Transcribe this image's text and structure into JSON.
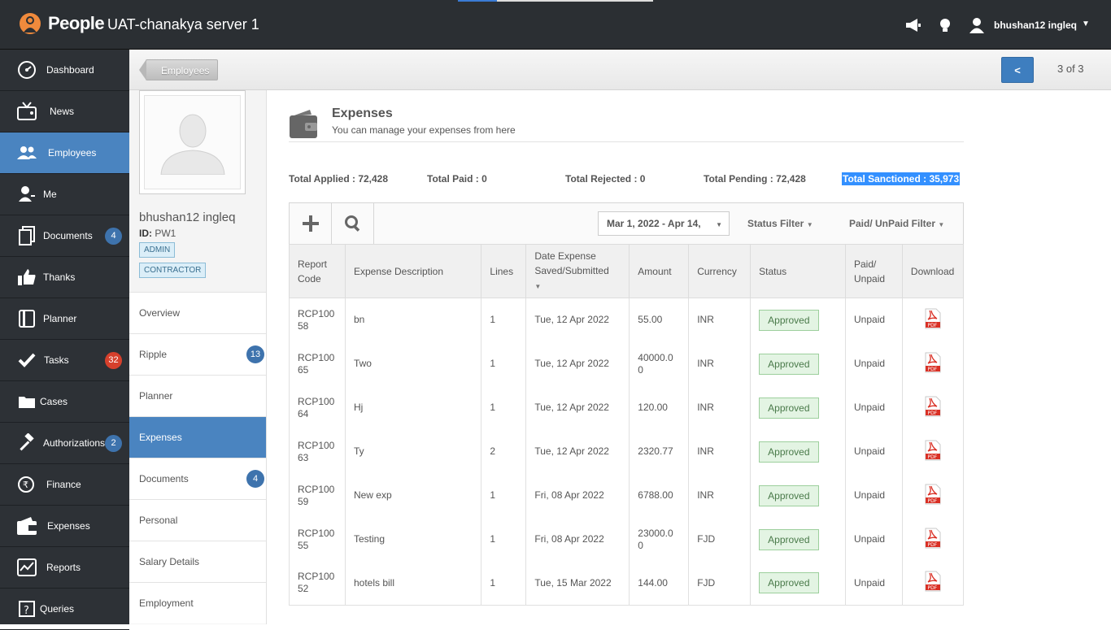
{
  "header": {
    "brand": "People",
    "server": "UAT-chanakya server 1",
    "user_name": "bhushan12 ingleq",
    "progress_fraction": 0.2
  },
  "sidebar": {
    "items": [
      {
        "label": "Dashboard",
        "icon": "dashboard-icon"
      },
      {
        "label": "News",
        "icon": "tv-icon"
      },
      {
        "label": "Employees",
        "icon": "users-icon",
        "active": true
      },
      {
        "label": "Me",
        "icon": "user-icon"
      },
      {
        "label": "Documents",
        "icon": "documents-icon",
        "badge": "4"
      },
      {
        "label": "Thanks",
        "icon": "thumbs-up-icon"
      },
      {
        "label": "Planner",
        "icon": "planner-icon"
      },
      {
        "label": "Tasks",
        "icon": "check-icon",
        "badge": "32",
        "badge_color": "red"
      },
      {
        "label": "Cases",
        "icon": "folder-icon"
      },
      {
        "label": "Authorizations",
        "icon": "gavel-icon",
        "badge": "2"
      },
      {
        "label": "Finance",
        "icon": "rupee-icon"
      },
      {
        "label": "Expenses",
        "icon": "wallet-icon"
      },
      {
        "label": "Reports",
        "icon": "chart-icon"
      },
      {
        "label": "Queries",
        "icon": "question-icon"
      }
    ]
  },
  "subheader": {
    "breadcrumb": "Employees",
    "prev_label": "<",
    "pager": "3 of 3"
  },
  "profile": {
    "name": "bhushan12 ingleq",
    "id_label": "ID:",
    "id_value": "PW1",
    "tags": [
      "ADMIN",
      "CONTRACTOR"
    ],
    "nav": [
      {
        "label": "Overview"
      },
      {
        "label": "Ripple",
        "badge": "13"
      },
      {
        "label": "Planner"
      },
      {
        "label": "Expenses",
        "active": true
      },
      {
        "label": "Documents",
        "badge": "4"
      },
      {
        "label": "Personal"
      },
      {
        "label": "Salary Details"
      },
      {
        "label": "Employment"
      }
    ]
  },
  "expenses": {
    "title": "Expenses",
    "subtitle": "You can manage your expenses from here",
    "totals": {
      "applied": "Total Applied : 72,428",
      "paid": "Total Paid : 0",
      "rejected": "Total Rejected : 0",
      "pending": "Total Pending : 72,428",
      "sanctioned": "Total Sanctioned : 35,973"
    },
    "date_range": "Mar 1, 2022 - Apr 14,",
    "status_filter": "Status Filter",
    "paid_filter": "Paid/ UnPaid Filter",
    "columns": [
      "Report Code",
      "Expense Description",
      "Lines",
      "Date Expense Saved/Submitted",
      "Amount",
      "Currency",
      "Status",
      "Paid/ Unpaid",
      "Download"
    ],
    "rows": [
      {
        "code": "RCP100 58",
        "desc": "bn",
        "lines": "1",
        "date": "Tue, 12 Apr 2022",
        "amount": "55.00",
        "currency": "INR",
        "status": "Approved",
        "paid": "Unpaid"
      },
      {
        "code": "RCP100 65",
        "desc": "Two",
        "lines": "1",
        "date": "Tue, 12 Apr 2022",
        "amount": "40000.0 0",
        "currency": "INR",
        "status": "Approved",
        "paid": "Unpaid"
      },
      {
        "code": "RCP100 64",
        "desc": "Hj",
        "lines": "1",
        "date": "Tue, 12 Apr 2022",
        "amount": "120.00",
        "currency": "INR",
        "status": "Approved",
        "paid": "Unpaid"
      },
      {
        "code": "RCP100 63",
        "desc": "Ty",
        "lines": "2",
        "date": "Tue, 12 Apr 2022",
        "amount": "2320.77",
        "currency": "INR",
        "status": "Approved",
        "paid": "Unpaid"
      },
      {
        "code": "RCP100 59",
        "desc": "New exp",
        "lines": "1",
        "date": "Fri, 08 Apr 2022",
        "amount": "6788.00",
        "currency": "INR",
        "status": "Approved",
        "paid": "Unpaid"
      },
      {
        "code": "RCP100 55",
        "desc": "Testing",
        "lines": "1",
        "date": "Fri, 08 Apr 2022",
        "amount": "23000.0 0",
        "currency": "FJD",
        "status": "Approved",
        "paid": "Unpaid"
      },
      {
        "code": "RCP100 52",
        "desc": "hotels bill",
        "lines": "1",
        "date": "Tue, 15 Mar 2022",
        "amount": "144.00",
        "currency": "FJD",
        "status": "Approved",
        "paid": "Unpaid"
      }
    ]
  }
}
